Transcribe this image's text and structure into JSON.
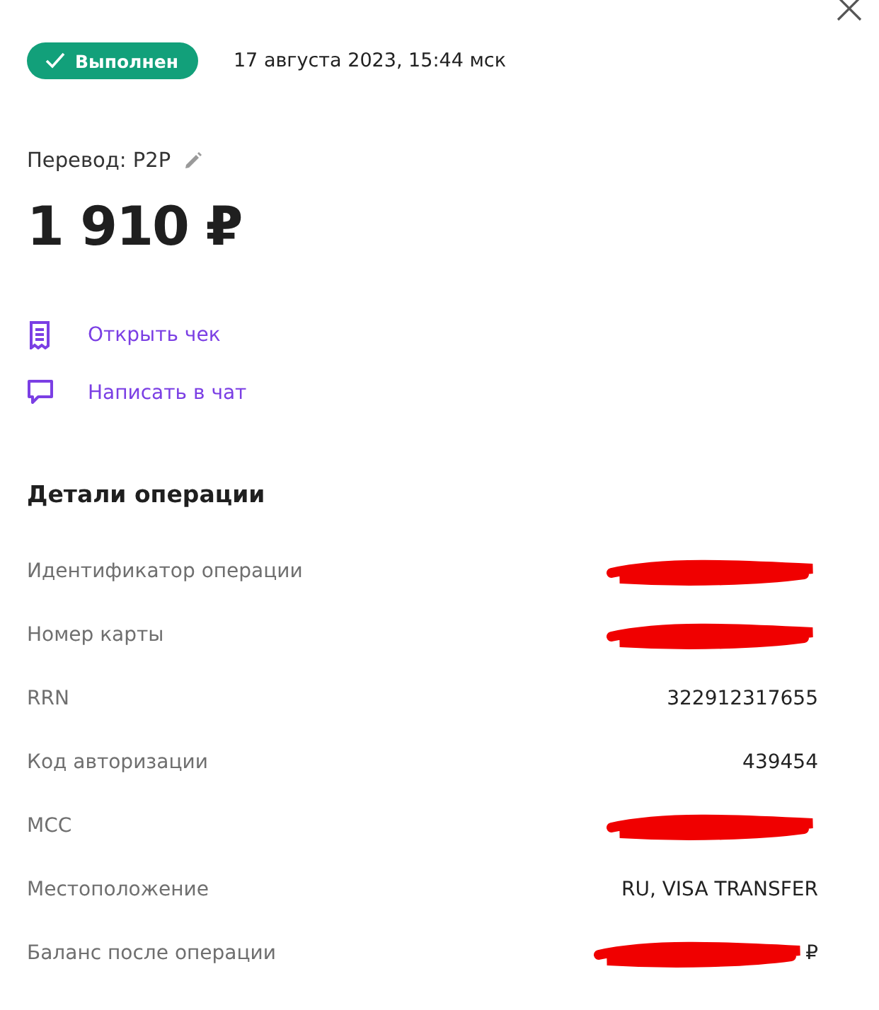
{
  "status": {
    "label": "Выполнен",
    "kind": "success"
  },
  "date": "17 августа 2023, 15:44 мск",
  "operation_type": "Перевод: P2P",
  "amount": "1 910 ₽",
  "actions": [
    {
      "label": "Открыть чек",
      "kind": "receipt"
    },
    {
      "label": "Написать в чат",
      "kind": "chat"
    }
  ],
  "details": {
    "title": "Детали операции",
    "rows": [
      {
        "label": "Идентификатор операции",
        "redacted": true
      },
      {
        "label": "Номер карты",
        "redacted": true
      },
      {
        "label": "RRN",
        "value": "322912317655",
        "redacted": false
      },
      {
        "label": "Код авторизации",
        "value": "439454",
        "redacted": false
      },
      {
        "label": "MCC",
        "redacted": true
      },
      {
        "label": "Местоположение",
        "value": "RU, VISA TRANSFER",
        "redacted": false
      },
      {
        "label": "Баланс после операции",
        "value": "₽",
        "redacted": true
      }
    ]
  }
}
